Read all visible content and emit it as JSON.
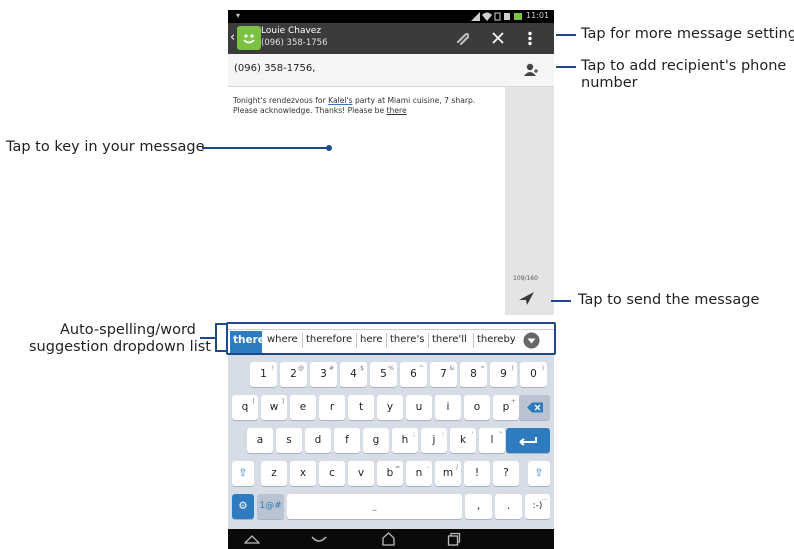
{
  "status": {
    "time": "11:01"
  },
  "conversation": {
    "contact_name": "Louie Chavez",
    "contact_phone": "(096) 358-1756"
  },
  "recipient_field": {
    "value": "(096) 358-1756,"
  },
  "message": {
    "text_before": "Tonight's rendezvous for ",
    "link_word": "Kalel's",
    "text_middle": " party at Miami cuisine, 7 sharp. Please acknowledge. Thanks! Please be ",
    "underlined_word": "there",
    "char_count": "109/160"
  },
  "suggestions": [
    "there",
    "where",
    "therefore",
    "here",
    "there's",
    "there'll",
    "thereby"
  ],
  "keyboard": {
    "row1": [
      {
        "k": "1",
        "s": "!"
      },
      {
        "k": "2",
        "s": "@"
      },
      {
        "k": "3",
        "s": "#"
      },
      {
        "k": "4",
        "s": "$"
      },
      {
        "k": "5",
        "s": "%"
      },
      {
        "k": "6",
        "s": "^"
      },
      {
        "k": "7",
        "s": "&"
      },
      {
        "k": "8",
        "s": "*"
      },
      {
        "k": "9",
        "s": "("
      },
      {
        "k": "0",
        "s": ")"
      }
    ],
    "row2": [
      {
        "k": "q",
        "s": "["
      },
      {
        "k": "w",
        "s": "]"
      },
      {
        "k": "e",
        "s": ""
      },
      {
        "k": "r",
        "s": ""
      },
      {
        "k": "t",
        "s": ""
      },
      {
        "k": "y",
        "s": ""
      },
      {
        "k": "u",
        "s": ""
      },
      {
        "k": "i",
        "s": ""
      },
      {
        "k": "o",
        "s": ""
      },
      {
        "k": "p",
        "s": "+"
      }
    ],
    "row3": [
      {
        "k": "a",
        "s": ""
      },
      {
        "k": "s",
        "s": ""
      },
      {
        "k": "d",
        "s": ""
      },
      {
        "k": "f",
        "s": ""
      },
      {
        "k": "g",
        "s": ""
      },
      {
        "k": "h",
        "s": ";"
      },
      {
        "k": "j",
        "s": ":"
      },
      {
        "k": "k",
        "s": "'"
      },
      {
        "k": "l",
        "s": "\""
      }
    ],
    "row4": [
      {
        "k": "z",
        "s": ""
      },
      {
        "k": "x",
        "s": ""
      },
      {
        "k": "c",
        "s": ""
      },
      {
        "k": "v",
        "s": ""
      },
      {
        "k": "b",
        "s": "="
      },
      {
        "k": "n",
        "s": "-"
      },
      {
        "k": "m",
        "s": "/"
      },
      {
        "k": "!",
        "s": ""
      },
      {
        "k": "?",
        "s": ""
      }
    ],
    "symbols_label": "1@#",
    "comma": ",",
    "period": ".",
    "smiley": ":-)",
    "smiley_sub": "..."
  },
  "callouts": {
    "settings": "Tap for more message settings",
    "add_recipient_line1": "Tap to add recipient's phone",
    "add_recipient_line2": "number",
    "compose": "Tap to key in your message",
    "send": "Tap to send the message",
    "suggest_line1": "Auto-spelling/word",
    "suggest_line2": "suggestion dropdown list"
  },
  "colors": {
    "accent": "#1f4a8a",
    "suggestion_highlight": "#2f7bbf",
    "app_icon": "#7cc242"
  }
}
